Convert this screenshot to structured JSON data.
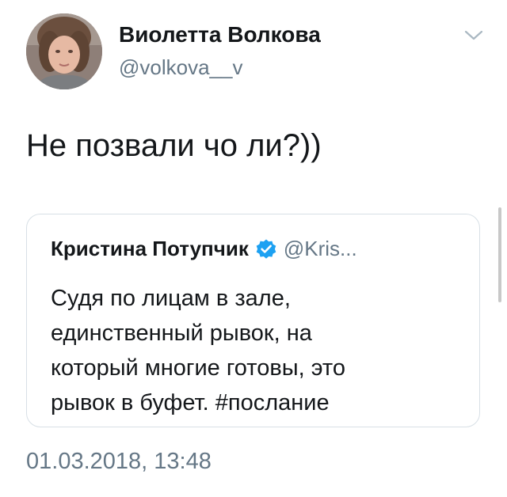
{
  "author": {
    "display_name": "Виолетта Волкова",
    "handle": "@volkova__v"
  },
  "tweet": {
    "text": "Не позвали чо ли?))",
    "timestamp": "01.03.2018, 13:48"
  },
  "quoted_tweet": {
    "display_name": "Кристина Потупчик",
    "verified": true,
    "handle": "@Kris...",
    "text_lines": [
      "Судя по лицам в зале,",
      "единственный рывок, на",
      "который многие готовы, это",
      "рывок в буфет. #послание"
    ]
  },
  "icons": {
    "menu": "chevron-down-icon",
    "verified": "verified-badge-icon"
  },
  "colors": {
    "text_primary": "#14171a",
    "text_secondary": "#657786",
    "verified_blue": "#1da1f2",
    "card_border": "#d8e0e6"
  }
}
